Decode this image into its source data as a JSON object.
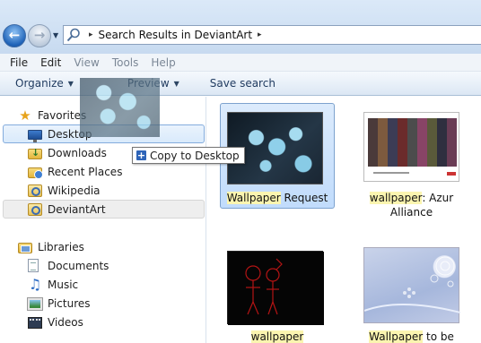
{
  "address": {
    "path_sep": "▸",
    "location": "Search Results in DeviantArt",
    "end_sep": "▸"
  },
  "menu": [
    "File",
    "Edit",
    "View",
    "Tools",
    "Help"
  ],
  "toolbar": {
    "organize_label": "Organize",
    "preview_label": "Preview",
    "save_search_label": "Save search"
  },
  "navigation": {
    "favorites_label": "Favorites",
    "favorites": [
      {
        "label": "Desktop",
        "icon": "desktop-icon"
      },
      {
        "label": "Downloads",
        "icon": "downloads-folder-icon"
      },
      {
        "label": "Recent Places",
        "icon": "recent-places-icon"
      },
      {
        "label": "Wikipedia",
        "icon": "saved-search-icon"
      },
      {
        "label": "DeviantArt",
        "icon": "saved-search-icon"
      }
    ],
    "libraries_label": "Libraries",
    "libraries": [
      {
        "label": "Documents",
        "icon": "documents-icon"
      },
      {
        "label": "Music",
        "icon": "music-icon"
      },
      {
        "label": "Pictures",
        "icon": "pictures-icon"
      },
      {
        "label": "Videos",
        "icon": "videos-icon"
      }
    ]
  },
  "results": [
    {
      "highlight": "Wallpaper",
      "rest": " Request",
      "selected": true
    },
    {
      "highlight": "wallpaper",
      "rest": ": Azur Alliance",
      "selected": false
    },
    {
      "highlight": "wallpaper",
      "rest": "",
      "selected": false
    },
    {
      "highlight": "Wallpaper",
      "rest": " to be",
      "selected": false
    }
  ],
  "drag": {
    "tooltip": "Copy to Desktop"
  },
  "colors": {
    "selection_bg": "#c1dcfc",
    "selection_border": "#7da2ce",
    "highlight": "#fbf5b0",
    "accent": "#2e64b8"
  }
}
